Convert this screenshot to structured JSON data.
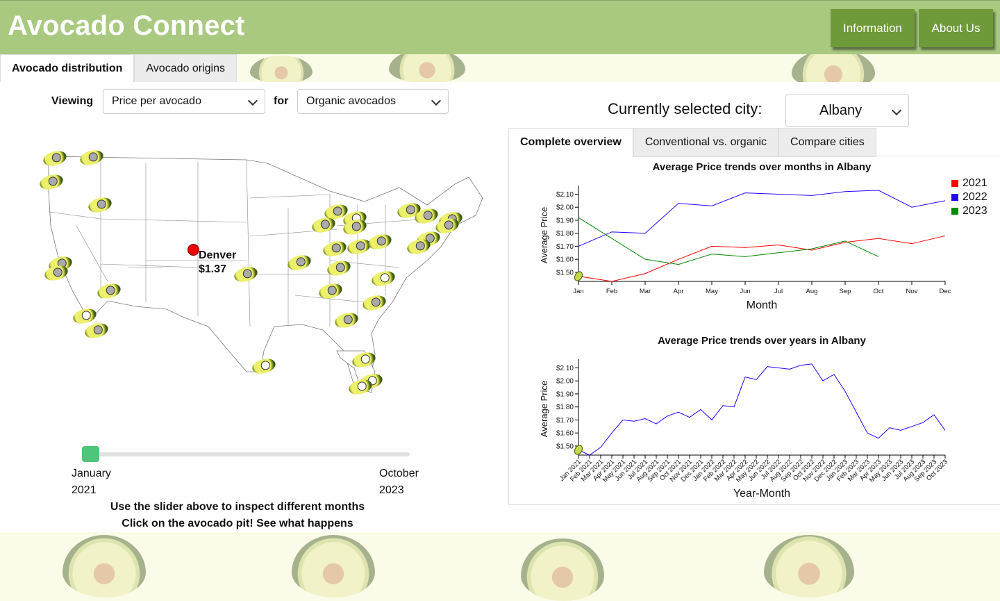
{
  "app": {
    "title": "Avocado Connect"
  },
  "header": {
    "buttons": [
      "Information",
      "About Us"
    ]
  },
  "main_tabs": [
    {
      "label": "Avocado distribution",
      "active": true
    },
    {
      "label": "Avocado origins",
      "active": false
    }
  ],
  "controls": {
    "viewing_label": "Viewing",
    "metric": "Price per avocado",
    "for_label": "for",
    "type": "Organic avocados"
  },
  "city": {
    "label": "Currently selected city:",
    "value": "Albany"
  },
  "right_tabs": [
    {
      "label": "Complete overview",
      "active": true
    },
    {
      "label": "Conventional vs. organic",
      "active": false
    },
    {
      "label": "Compare cities",
      "active": false
    }
  ],
  "map": {
    "selected": {
      "name": "Denver",
      "price": "$1.37"
    }
  },
  "slider": {
    "start_month": "January",
    "start_year": "2021",
    "end_month": "October",
    "end_year": "2023",
    "position": 0.0
  },
  "hints": [
    "Use the slider above to inspect different months",
    "Click on the avocado pit! See what happens"
  ],
  "colors": {
    "header": "#a8c97f",
    "button": "#6f9a3a",
    "y2021": "#ff0000",
    "y2022": "#2200ff",
    "y2023": "#008800",
    "slider": "#4fc47b"
  },
  "chart_data": [
    {
      "type": "line",
      "title": "Average Price trends over months in Albany",
      "xlabel": "Month",
      "ylabel": "Average Price",
      "categories": [
        "Jan",
        "Feb",
        "Mar",
        "Apr",
        "May",
        "Jun",
        "Jul",
        "Aug",
        "Sep",
        "Oct",
        "Nov",
        "Dec"
      ],
      "ylim": [
        1.43,
        2.14
      ],
      "yticks": [
        "$1.50",
        "$1.60",
        "$1.70",
        "$1.80",
        "$1.90",
        "$2.00",
        "$2.10"
      ],
      "legend": "top-right",
      "series": [
        {
          "name": "2021",
          "color": "#ff0000",
          "values": [
            1.47,
            1.43,
            1.49,
            1.6,
            1.7,
            1.69,
            1.71,
            1.67,
            1.73,
            1.76,
            1.72,
            1.78
          ]
        },
        {
          "name": "2022",
          "color": "#2200ff",
          "values": [
            1.7,
            1.81,
            1.8,
            2.03,
            2.01,
            2.11,
            2.1,
            2.09,
            2.12,
            2.13,
            2.0,
            2.05
          ]
        },
        {
          "name": "2023",
          "color": "#008800",
          "values": [
            1.92,
            1.76,
            1.6,
            1.56,
            1.64,
            1.62,
            1.65,
            1.68,
            1.74,
            1.62
          ]
        }
      ]
    },
    {
      "type": "line",
      "title": "Average Price trends over years in Albany",
      "xlabel": "Year-Month",
      "ylabel": "Average Price",
      "categories": [
        "Jan 2021",
        "Feb 2021",
        "Mar 2021",
        "Apr 2021",
        "May 2021",
        "Jun 2021",
        "Jul 2021",
        "Aug 2021",
        "Sep 2021",
        "Oct 2021",
        "Nov 2021",
        "Dec 2021",
        "Jan 2022",
        "Feb 2022",
        "Mar 2022",
        "Apr 2022",
        "May 2022",
        "Jun 2022",
        "Jul 2022",
        "Aug 2022",
        "Sep 2022",
        "Oct 2022",
        "Nov 2022",
        "Dec 2022",
        "Jan 2023",
        "Feb 2023",
        "Mar 2023",
        "Apr 2023",
        "May 2023",
        "Jun 2023",
        "Jul 2023",
        "Aug 2023",
        "Sep 2023",
        "Oct 2023"
      ],
      "ylim": [
        1.43,
        2.14
      ],
      "yticks": [
        "$1.50",
        "$1.60",
        "$1.70",
        "$1.80",
        "$1.90",
        "$2.00",
        "$2.10"
      ],
      "series": [
        {
          "color": "#2200ff",
          "values": [
            1.47,
            1.43,
            1.49,
            1.6,
            1.7,
            1.69,
            1.71,
            1.67,
            1.73,
            1.76,
            1.72,
            1.78,
            1.7,
            1.81,
            1.8,
            2.03,
            2.01,
            2.11,
            2.1,
            2.09,
            2.12,
            2.13,
            2.0,
            2.05,
            1.92,
            1.76,
            1.6,
            1.56,
            1.64,
            1.62,
            1.65,
            1.68,
            1.74,
            1.62
          ]
        }
      ]
    }
  ]
}
